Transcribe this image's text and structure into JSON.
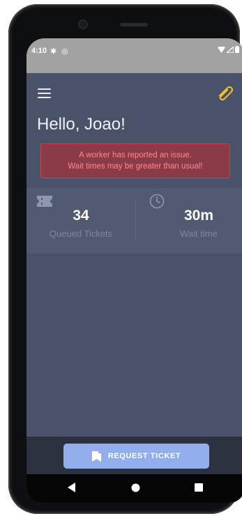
{
  "status_bar": {
    "time": "4:10"
  },
  "header": {
    "greeting": "Hello, Joao!"
  },
  "alert": {
    "line1": "A worker has reported an issue.",
    "line2": "Wait times may be greater than usual!"
  },
  "stats": {
    "queued": {
      "value": "34",
      "label": "Queued Tickets"
    },
    "wait": {
      "value": "30m",
      "label": "Wait time"
    }
  },
  "actions": {
    "request_label": "REQUEST TICKET"
  },
  "colors": {
    "background": "#4a5269",
    "alert_text": "#ff8a8a",
    "accent": "#93aeec",
    "clip_icon": "#f2c12e"
  },
  "icons": [
    "menu-icon",
    "paperclip-icon",
    "ticket-icon",
    "clock-icon",
    "bookmark-ticket-icon"
  ]
}
